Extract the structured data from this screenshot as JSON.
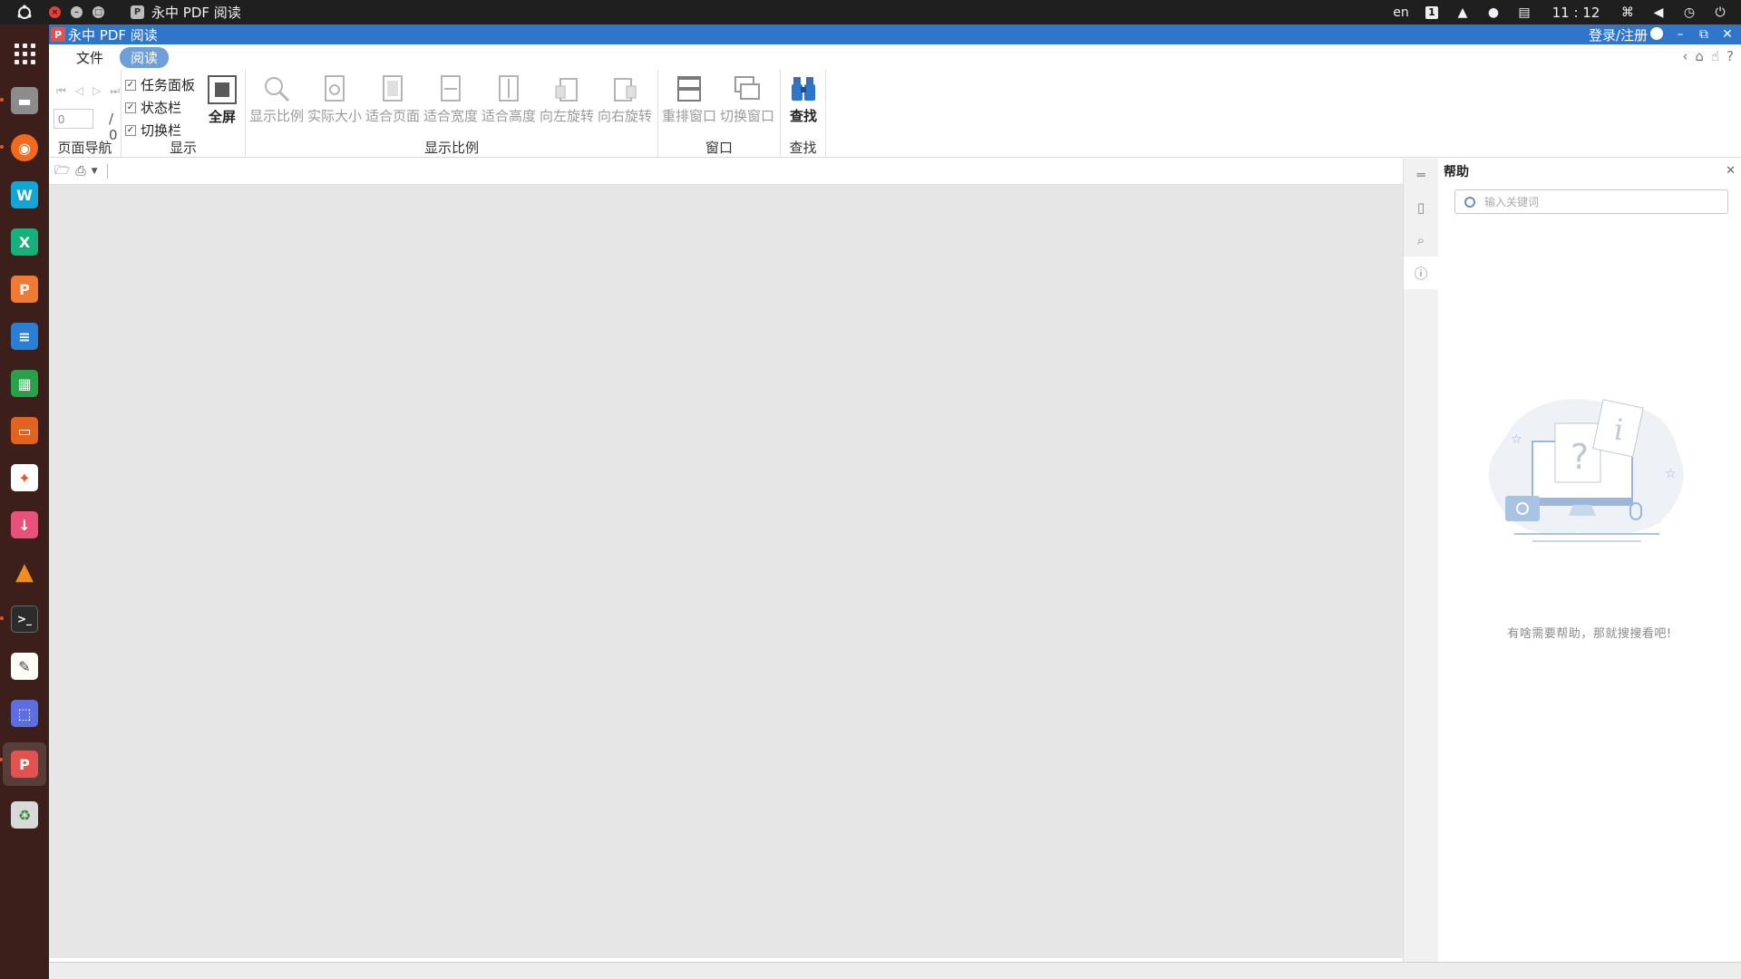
{
  "system_panel": {
    "window_title": "永中 PDF 阅读",
    "app_icon_letter": "P",
    "language": "en",
    "workspace": "1",
    "clock": "11 : 12"
  },
  "launcher": {
    "items": [
      "apps-grid-icon",
      "files-icon",
      "firefox-icon",
      "wps-writer-icon",
      "xmind-icon",
      "wps-presentation-icon",
      "writer-icon",
      "calc-icon",
      "impress-icon",
      "software-center-icon",
      "download-icon",
      "vlc-icon",
      "terminal-icon",
      "text-editor-icon",
      "screenshot-icon",
      "yozo-pdf-icon",
      "trash-icon"
    ]
  },
  "window": {
    "title": "永中 PDF 阅读",
    "login_label": "登录/注册",
    "min": "–",
    "restore": "⧉",
    "close": "✕"
  },
  "menu": {
    "file": "文件",
    "read": "阅读"
  },
  "ribbon": {
    "page_nav": {
      "label": "页面导航",
      "page_value": "0",
      "page_total": "/ 0"
    },
    "display": {
      "label": "显示",
      "task_panel": "任务面板",
      "status_bar": "状态栏",
      "switch_bar": "切换栏",
      "fullscreen": "全屏"
    },
    "zoom": {
      "label": "显示比例",
      "show_scale": "显示比例",
      "actual_size": "实际大小",
      "fit_page": "适合页面",
      "fit_width": "适合宽度",
      "fit_height": "适合高度",
      "rotate_left": "向左旋转",
      "rotate_right": "向右旋转"
    },
    "window_group": {
      "label": "窗口",
      "arrange": "重排窗口",
      "switch": "切换窗口"
    },
    "find_group": {
      "label": "查找",
      "find": "查找"
    }
  },
  "help_panel": {
    "title": "帮助",
    "search_placeholder": "输入关键词",
    "empty_message": "有啥需要帮助，那就搜搜看吧!"
  },
  "colors": {
    "titlebar": "#2f75c9",
    "launcher_bg": "#3c1f1a",
    "accent_tab": "#6f9ed8"
  }
}
